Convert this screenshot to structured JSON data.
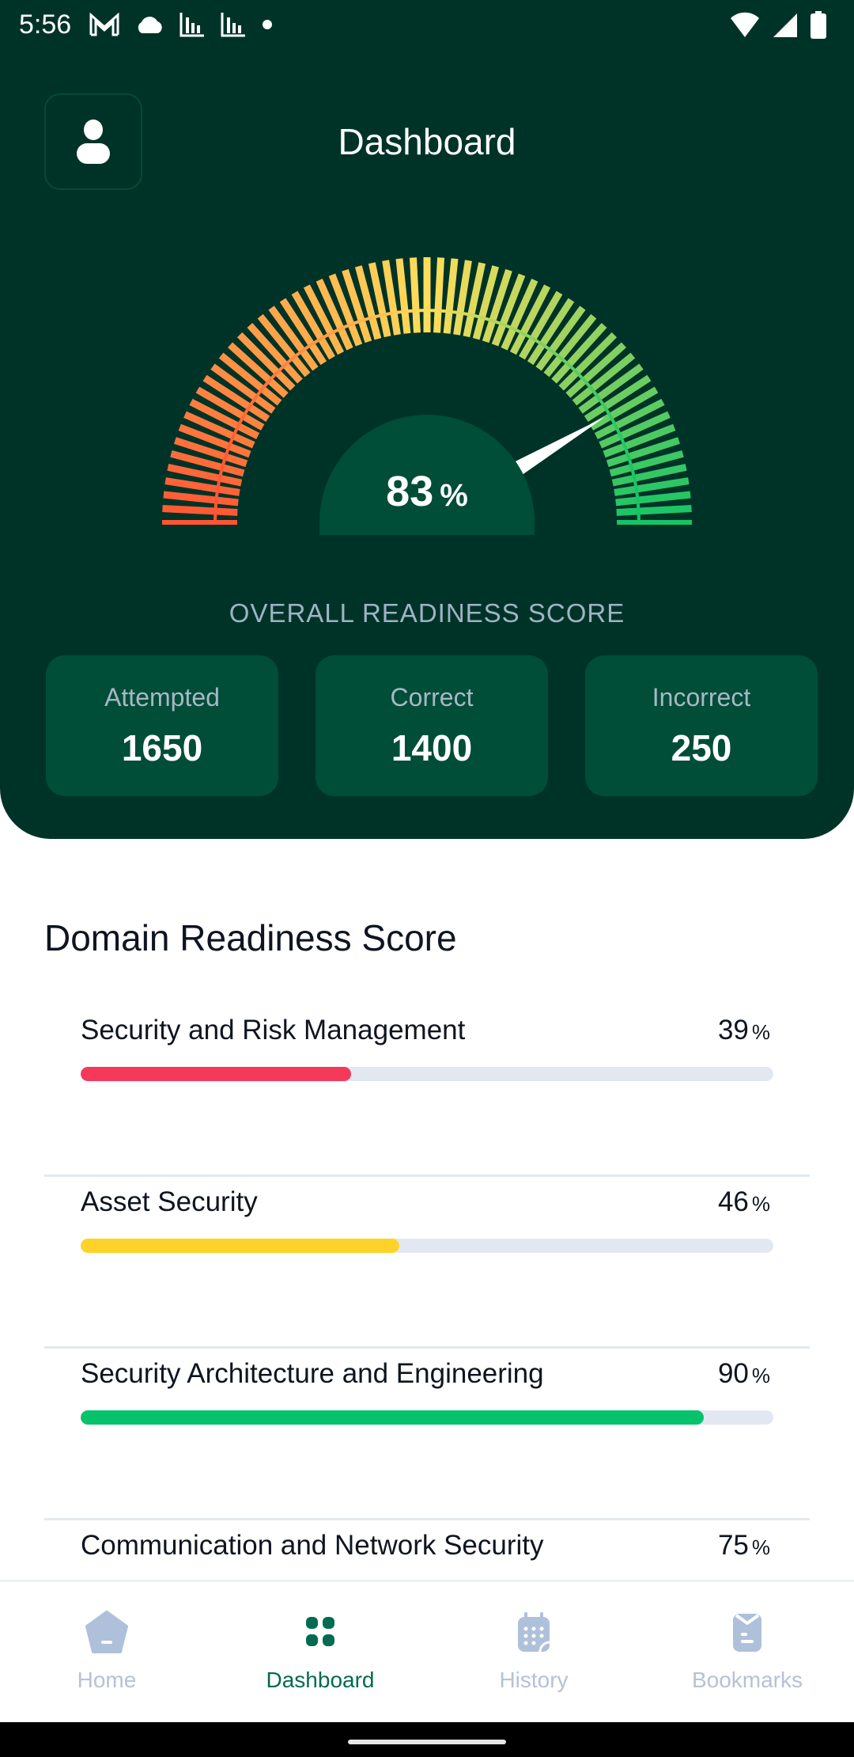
{
  "status_bar": {
    "time": "5:56",
    "left_icons": [
      "gmail-icon",
      "cloud-icon",
      "chart-icon",
      "chart-icon",
      "dot-icon"
    ],
    "right_icons": [
      "wifi-icon",
      "signal-icon",
      "battery-icon"
    ]
  },
  "header": {
    "title": "Dashboard",
    "profile_icon": "person-icon"
  },
  "gauge": {
    "value": 83,
    "value_text": "83",
    "unit": "%",
    "min": 0,
    "max": 100,
    "label": "OVERALL READINESS SCORE",
    "colors": {
      "low": "#ff5533",
      "mid": "#ffde5a",
      "high": "#15c465",
      "dome": "#004d38",
      "needle": "#ffffff"
    }
  },
  "stats": [
    {
      "label": "Attempted",
      "value": "1650"
    },
    {
      "label": "Correct",
      "value": "1400"
    },
    {
      "label": "Incorrect",
      "value": "250"
    }
  ],
  "domains": {
    "title": "Domain Readiness Score",
    "items": [
      {
        "name": "Security and Risk Management",
        "percent": 39,
        "percent_text": "39",
        "unit": "%",
        "color": "#f5395b"
      },
      {
        "name": "Asset Security",
        "percent": 46,
        "percent_text": "46",
        "unit": "%",
        "color": "#ffd22a"
      },
      {
        "name": "Security Architecture and Engineering",
        "percent": 90,
        "percent_text": "90",
        "unit": "%",
        "color": "#06c36b"
      },
      {
        "name": "Communication and Network Security",
        "percent": 75,
        "percent_text": "75",
        "unit": "%",
        "color": "#06c36b"
      }
    ]
  },
  "bottom_nav": {
    "items": [
      {
        "label": "Home",
        "icon": "home-icon",
        "active": false
      },
      {
        "label": "Dashboard",
        "icon": "dashboard-icon",
        "active": true
      },
      {
        "label": "History",
        "icon": "calendar-icon",
        "active": false
      },
      {
        "label": "Bookmarks",
        "icon": "bookmark-icon",
        "active": false
      }
    ],
    "active_color": "#036b4f",
    "inactive_color": "#afc0da"
  }
}
